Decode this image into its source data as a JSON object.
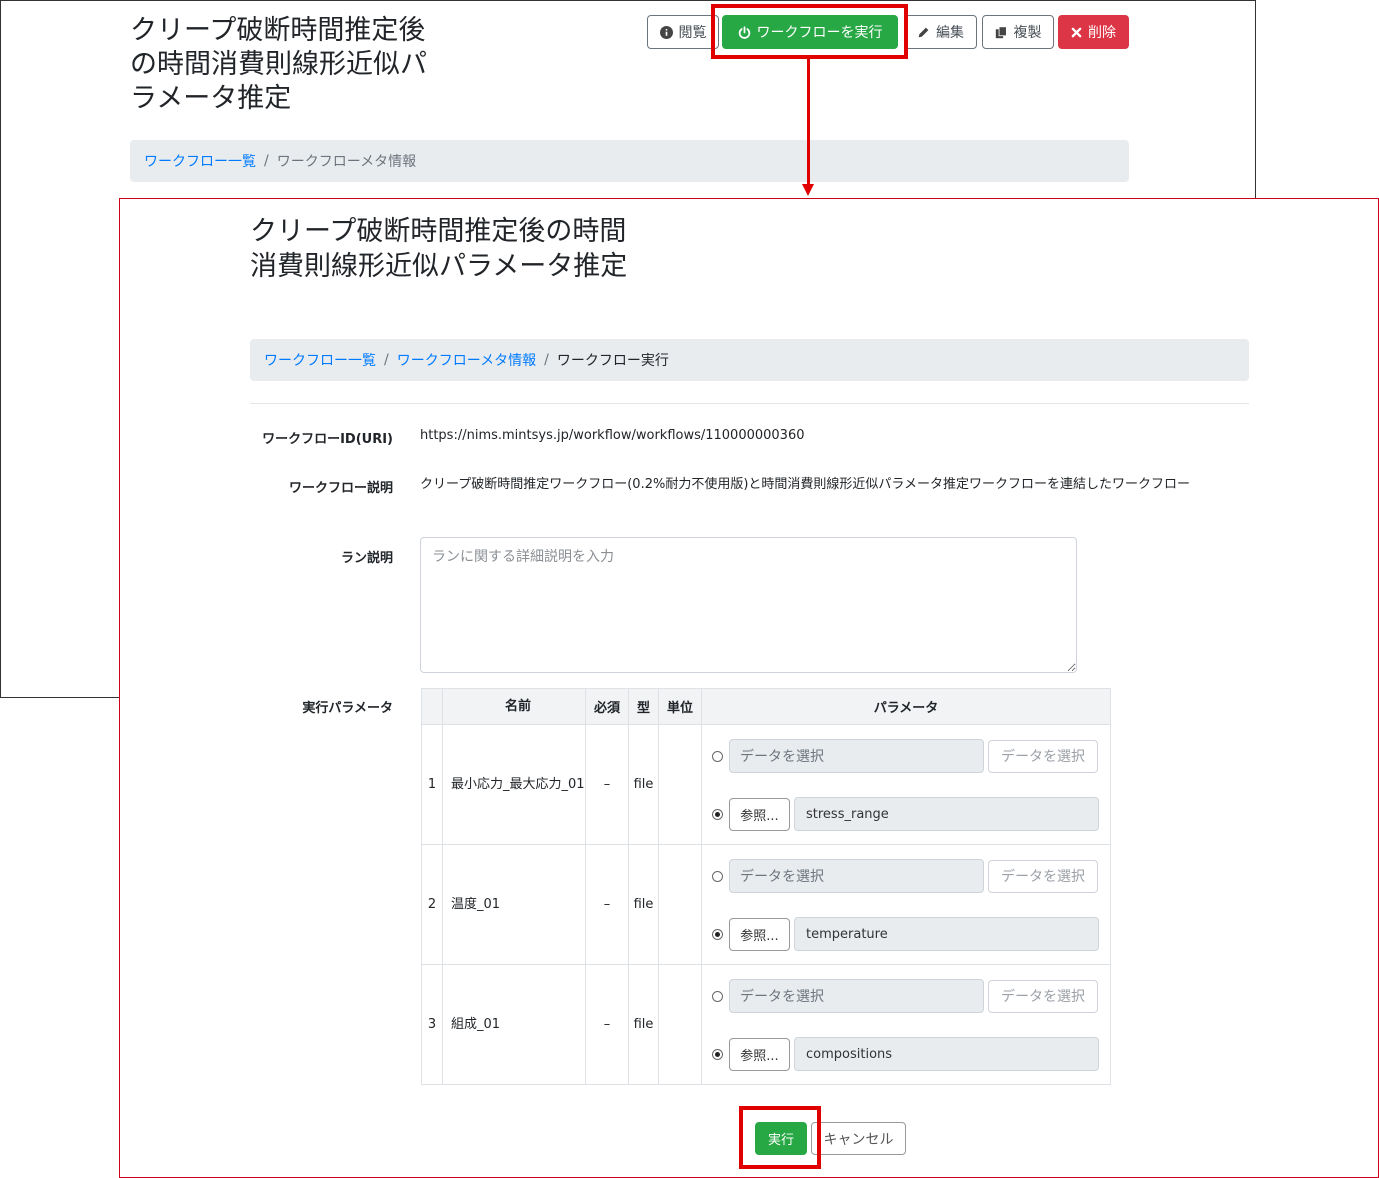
{
  "back": {
    "title": "クリープ破断時間推定後の時間消費則線形近似パラメータ推定",
    "buttons": {
      "view": "閲覧",
      "run": "ワークフローを実行",
      "edit": "編集",
      "copy": "複製",
      "delete": "削除"
    },
    "breadcrumb": {
      "item1": "ワークフロー一覧",
      "item2": "ワークフローメタ情報"
    }
  },
  "front": {
    "title": "クリープ破断時間推定後の時間消費則線形近似パラメータ推定",
    "breadcrumb": {
      "item1": "ワークフロー一覧",
      "item2": "ワークフローメタ情報",
      "item3": "ワークフロー実行"
    },
    "workflow_id_label": "ワークフローID(URI)",
    "workflow_id_value": "https://nims.mintsys.jp/workflow/workflows/110000000360",
    "workflow_desc_label": "ワークフロー説明",
    "workflow_desc_value": "クリープ破断時間推定ワークフロー(0.2%耐力不使用版)と時間消費則線形近似パラメータ推定ワークフローを連結したワークフロー",
    "run_desc_label": "ラン説明",
    "run_desc_placeholder": "ランに関する詳細説明を入力",
    "params_label": "実行パラメータ",
    "table": {
      "headers": {
        "name": "名前",
        "required": "必須",
        "type": "型",
        "unit": "単位",
        "param": "パラメータ"
      },
      "rows": [
        {
          "no": "1",
          "name": "最小応力_最大応力_01",
          "required": "–",
          "type": "file",
          "data_placeholder": "データを選択",
          "data_button": "データを選択",
          "ref_button": "参照...",
          "ref_value": "stress_range"
        },
        {
          "no": "2",
          "name": "温度_01",
          "required": "–",
          "type": "file",
          "data_placeholder": "データを選択",
          "data_button": "データを選択",
          "ref_button": "参照...",
          "ref_value": "temperature"
        },
        {
          "no": "3",
          "name": "組成_01",
          "required": "–",
          "type": "file",
          "data_placeholder": "データを選択",
          "data_button": "データを選択",
          "ref_button": "参照...",
          "ref_value": "compositions"
        }
      ]
    },
    "exec_button": "実行",
    "cancel_button": "キャンセル"
  },
  "colors": {
    "success": "#28a745",
    "danger": "#dc3545",
    "link": "#007bff",
    "highlight": "#e00000"
  }
}
